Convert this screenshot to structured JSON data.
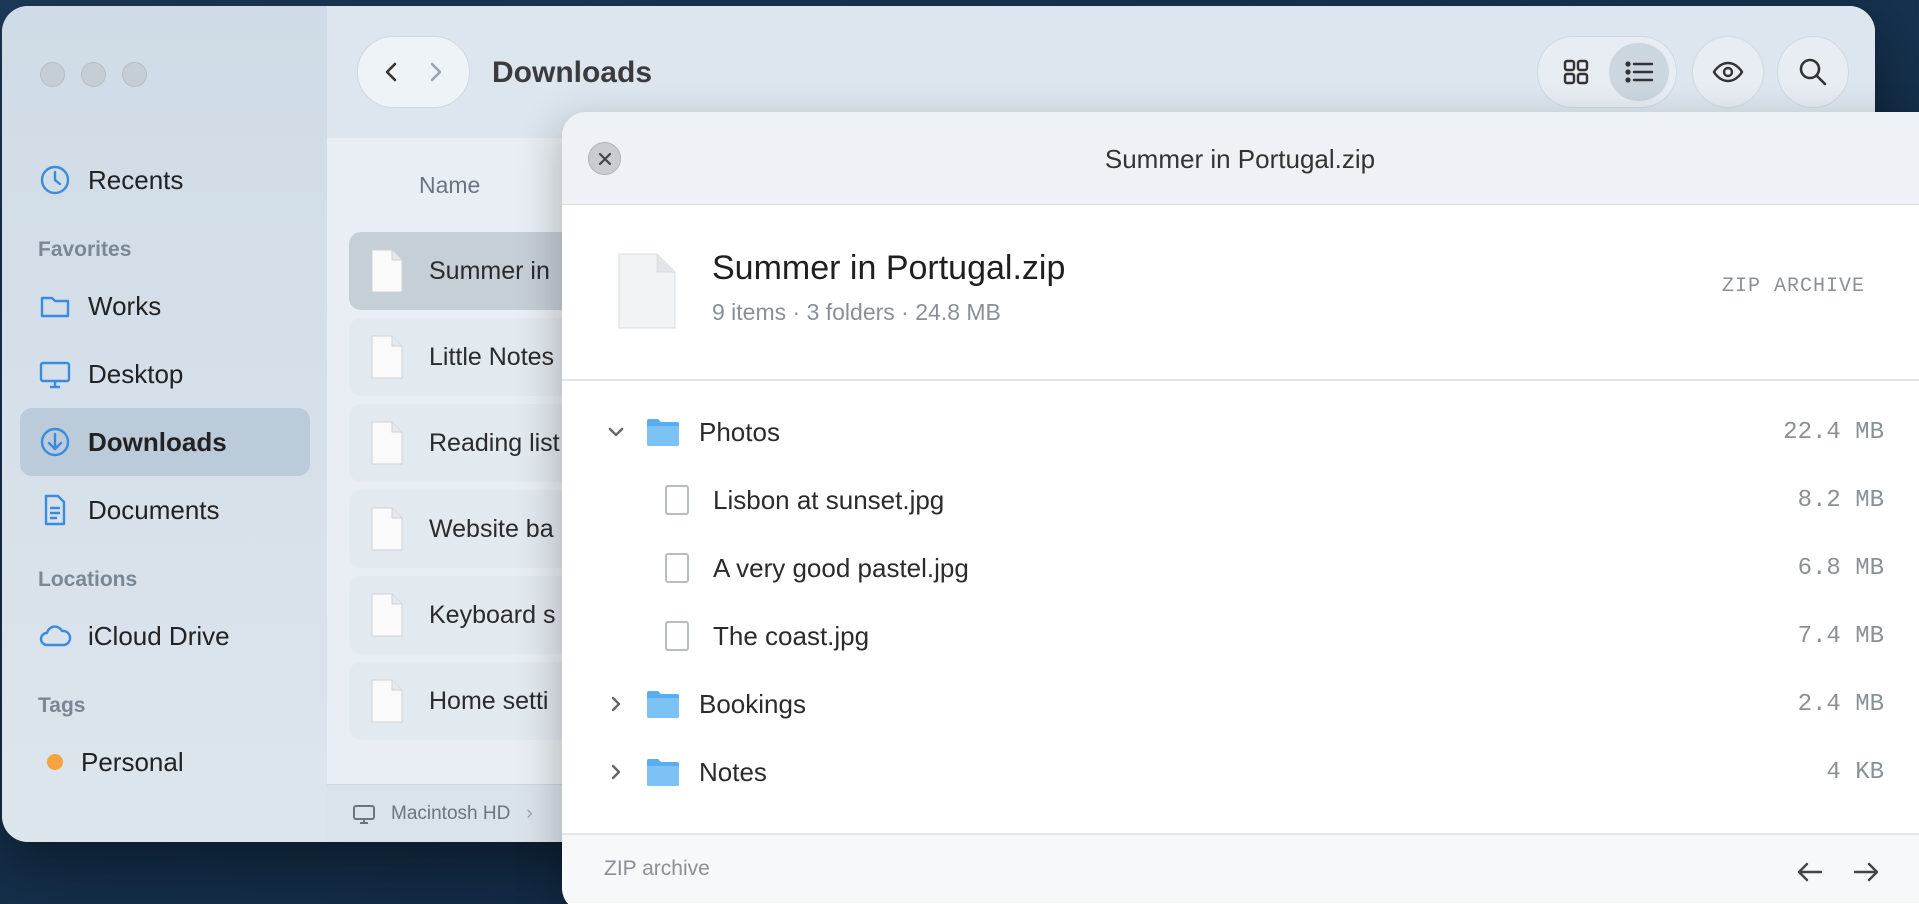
{
  "finder": {
    "toolbar_title": "Downloads",
    "sidebar": {
      "items_top": [
        {
          "label": "Recents",
          "icon": "clock-icon"
        }
      ],
      "favorites_heading": "Favorites",
      "favorites": [
        {
          "label": "Works",
          "icon": "folder-icon"
        },
        {
          "label": "Desktop",
          "icon": "desktop-icon"
        },
        {
          "label": "Downloads",
          "icon": "download-icon",
          "active": true
        },
        {
          "label": "Documents",
          "icon": "document-icon"
        }
      ],
      "locations_heading": "Locations",
      "locations": [
        {
          "label": "iCloud Drive",
          "icon": "cloud-icon"
        }
      ],
      "tags_heading": "Tags",
      "tags": [
        {
          "label": "Personal",
          "color": "#f5a33c"
        }
      ]
    },
    "column_header": "Name",
    "files": [
      {
        "name": "Summer in",
        "selected": true
      },
      {
        "name": "Little Notes"
      },
      {
        "name": "Reading list"
      },
      {
        "name": "Website ba"
      },
      {
        "name": "Keyboard s"
      },
      {
        "name": "Home setti"
      }
    ],
    "path_bar": {
      "disk": "Macintosh HD",
      "separator": "›"
    }
  },
  "quicklook": {
    "title": "Summer in Portugal.zip",
    "file_name": "Summer in Portugal.zip",
    "meta": "9 items · 3 folders · 24.8 MB",
    "kind": "ZIP ARCHIVE",
    "tree": [
      {
        "label": "Photos",
        "type": "folder",
        "expanded": true,
        "size": "22.4 MB"
      },
      {
        "label": "Lisbon at sunset.jpg",
        "type": "file",
        "size": "8.2 MB"
      },
      {
        "label": "A very good pastel.jpg",
        "type": "file",
        "size": "6.8 MB"
      },
      {
        "label": "The coast.jpg",
        "type": "file",
        "size": "7.4 MB"
      },
      {
        "label": "Bookings",
        "type": "folder",
        "expanded": false,
        "size": "2.4 MB"
      },
      {
        "label": "Notes",
        "type": "folder",
        "expanded": false,
        "size": "4 KB"
      }
    ],
    "footer_label": "ZIP archive"
  },
  "colors": {
    "accent": "#3a8be0",
    "folder": "#5aaef0",
    "tag_personal": "#f5a33c"
  }
}
